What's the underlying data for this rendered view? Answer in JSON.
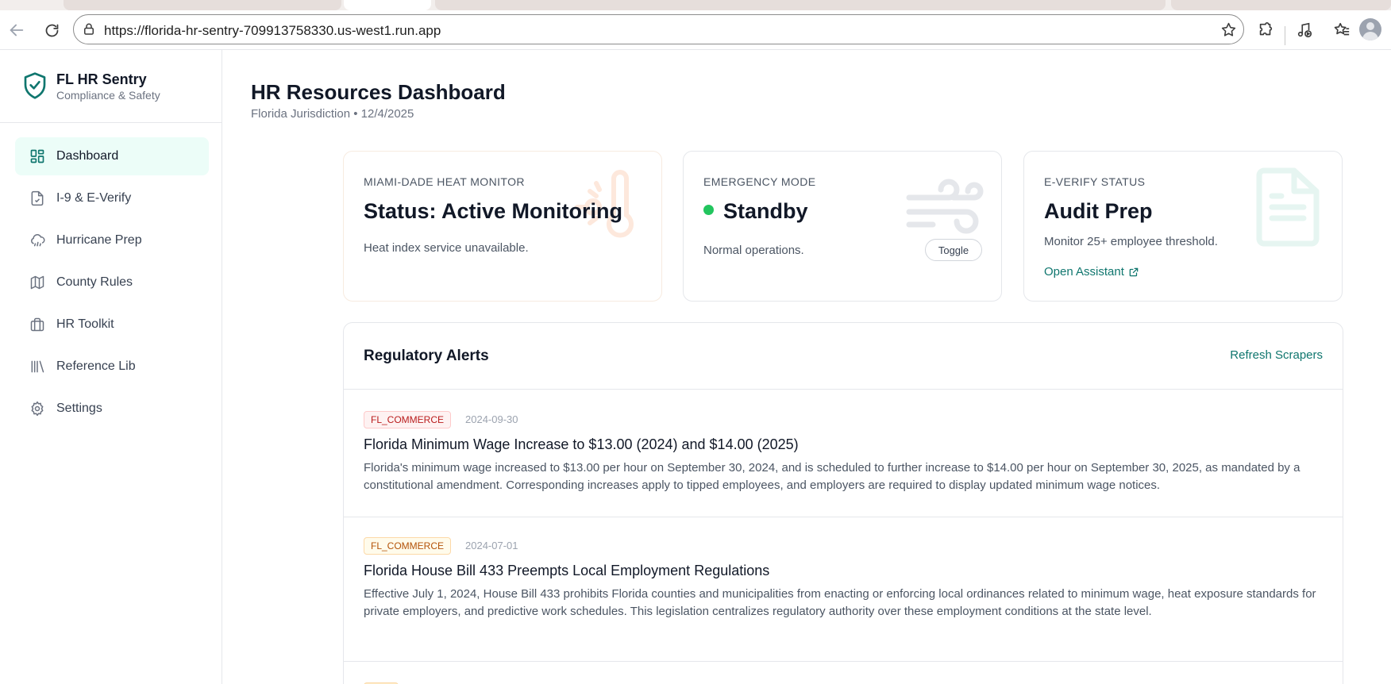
{
  "browser": {
    "url": "https://florida-hr-sentry-709913758330.us-west1.run.app"
  },
  "sidebar": {
    "brand_name": "FL HR Sentry",
    "brand_tagline": "Compliance & Safety",
    "items": [
      {
        "label": "Dashboard",
        "icon": "grid-icon",
        "active": true
      },
      {
        "label": "I-9 & E-Verify",
        "icon": "file-check-icon",
        "active": false
      },
      {
        "label": "Hurricane Prep",
        "icon": "cloud-rain-icon",
        "active": false
      },
      {
        "label": "County Rules",
        "icon": "map-icon",
        "active": false
      },
      {
        "label": "HR Toolkit",
        "icon": "briefcase-icon",
        "active": false
      },
      {
        "label": "Reference Lib",
        "icon": "library-icon",
        "active": false
      },
      {
        "label": "Settings",
        "icon": "gear-icon",
        "active": false
      }
    ]
  },
  "header": {
    "title": "HR Resources Dashboard",
    "subtitle": "Florida Jurisdiction • 12/4/2025"
  },
  "cards": {
    "heat": {
      "label": "MIAMI-DADE HEAT MONITOR",
      "value": "Status: Active Monitoring",
      "desc": "Heat index service unavailable."
    },
    "emergency": {
      "label": "EMERGENCY MODE",
      "value": "Standby",
      "desc": "Normal operations.",
      "toggle_label": "Toggle",
      "status_color": "#22c55e"
    },
    "everify": {
      "label": "E-VERIFY STATUS",
      "value": "Audit Prep",
      "desc": "Monitor 25+ employee threshold.",
      "link_label": "Open Assistant"
    }
  },
  "alerts": {
    "title": "Regulatory Alerts",
    "refresh_label": "Refresh Scrapers",
    "items": [
      {
        "source": "FL_COMMERCE",
        "date": "2024-09-30",
        "title": "Florida Minimum Wage Increase to $13.00 (2024) and $14.00 (2025)",
        "body": "Florida's minimum wage increased to $13.00 per hour on September 30, 2024, and is scheduled to further increase to $14.00 per hour on September 30, 2025, as mandated by a constitutional amendment. Corresponding increases apply to tipped employees, and employers are required to display updated minimum wage notices."
      },
      {
        "source": "FL_COMMERCE",
        "date": "2024-07-01",
        "title": "Florida House Bill 433 Preempts Local Employment Regulations",
        "body": "Effective July 1, 2024, House Bill 433 prohibits Florida counties and municipalities from enacting or enforcing local ordinances related to minimum wage, heat exposure standards for private employers, and predictive work schedules. This legislation centralizes regulatory authority over these employment conditions at the state level."
      }
    ]
  },
  "colors": {
    "accent": "#0f766e",
    "active_nav_bg": "#ecfdf8"
  }
}
